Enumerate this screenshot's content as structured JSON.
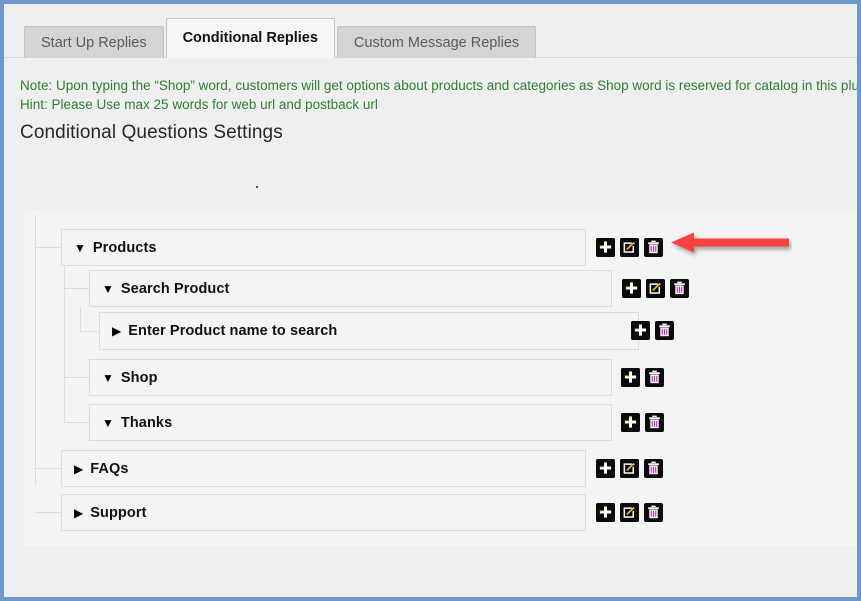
{
  "window": {
    "border_color": "#6f97c9",
    "background": "#efefef",
    "panel_background": "#f4f4f4"
  },
  "tabs": [
    {
      "label": "Start Up Replies",
      "active": false
    },
    {
      "label": "Conditional Replies",
      "active": true
    },
    {
      "label": "Custom Message Replies",
      "active": false
    }
  ],
  "notes": {
    "color": "#2f7d32",
    "lines": [
      "Note: Upon typing the “Shop” word, customers will get options about products and categories as Shop word is reserved for catalog in this plugin",
      "Hint: Please Use max 25 words for web url and postback url"
    ]
  },
  "heading": "Conditional Questions Settings",
  "icon_labels": {
    "add": "add-icon",
    "edit": "edit-icon",
    "delete": "delete-icon"
  },
  "annotation": {
    "type": "arrow-left",
    "color": "#f8423f",
    "points_to": "Products row delete button"
  },
  "tree": [
    {
      "id": "products",
      "label": "Products",
      "caret": "▼",
      "expanded": true,
      "depth": 0,
      "actions": [
        "add",
        "edit",
        "delete"
      ]
    },
    {
      "id": "search-product",
      "label": "Search Product",
      "caret": "▼",
      "expanded": true,
      "depth": 1,
      "actions": [
        "add",
        "edit",
        "delete"
      ]
    },
    {
      "id": "enter-product-name-to-search",
      "label": "Enter Product name to search",
      "caret": "▶",
      "expanded": false,
      "depth": 2,
      "actions": [
        "add",
        "delete"
      ]
    },
    {
      "id": "shop",
      "label": "Shop",
      "caret": "▼",
      "expanded": true,
      "depth": 1,
      "actions": [
        "add",
        "delete"
      ]
    },
    {
      "id": "thanks",
      "label": "Thanks",
      "caret": "▼",
      "expanded": true,
      "depth": 1,
      "actions": [
        "add",
        "delete"
      ]
    },
    {
      "id": "faqs",
      "label": "FAQs",
      "caret": "▶",
      "expanded": false,
      "depth": 0,
      "actions": [
        "add",
        "edit",
        "delete"
      ]
    },
    {
      "id": "support",
      "label": "Support",
      "caret": "▶",
      "expanded": false,
      "depth": 0,
      "actions": [
        "add",
        "edit",
        "delete"
      ]
    }
  ]
}
